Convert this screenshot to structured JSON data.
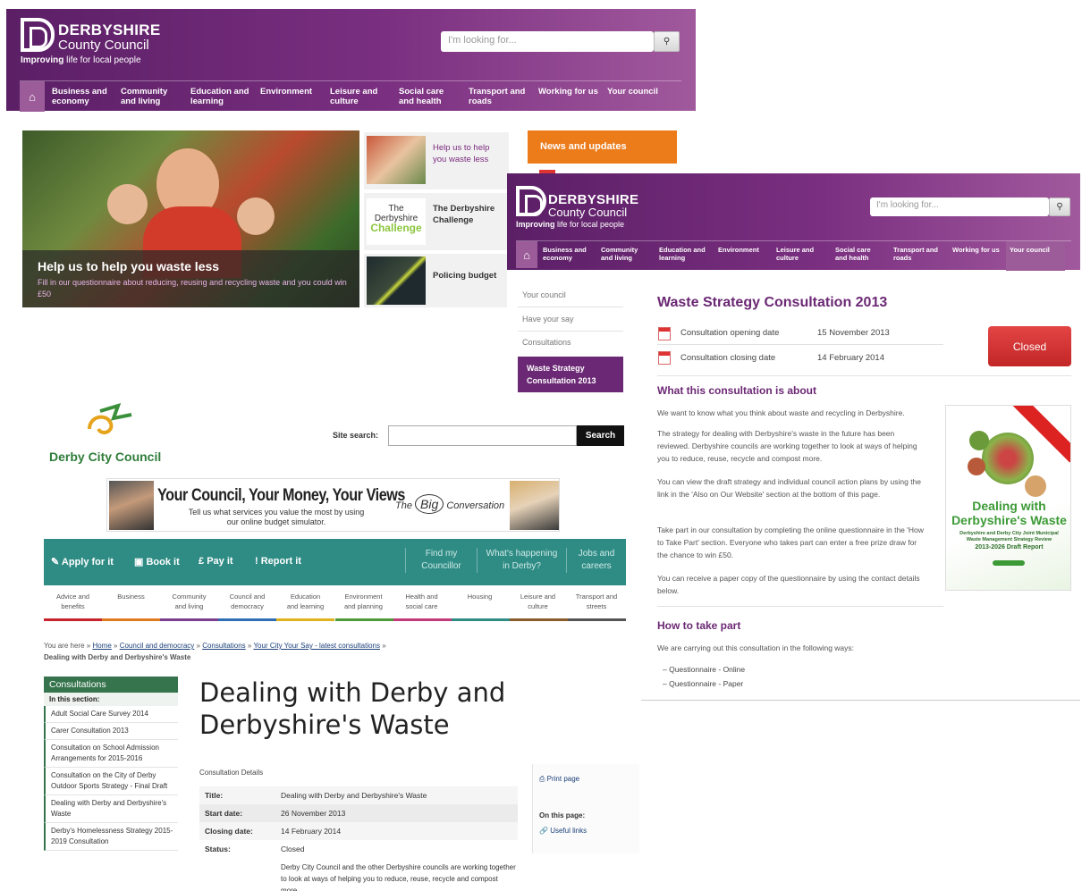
{
  "window_a": {
    "logo": {
      "name": "DERBYSHIRE",
      "sub": "County Council",
      "tagline_bold": "Improving",
      "tagline_rest": " life for local people"
    },
    "search": {
      "placeholder": "I'm looking for..."
    },
    "nav": [
      {
        "l1": "Business and",
        "l2": "economy"
      },
      {
        "l1": "Community",
        "l2": "and living"
      },
      {
        "l1": "Education and",
        "l2": "learning"
      },
      {
        "l1": "Environment",
        "l2": ""
      },
      {
        "l1": "Leisure and",
        "l2": "culture"
      },
      {
        "l1": "Social care",
        "l2": "and health"
      },
      {
        "l1": "Transport and",
        "l2": "roads"
      },
      {
        "l1": "Working for us",
        "l2": ""
      },
      {
        "l1": "Your council",
        "l2": ""
      }
    ],
    "hero": {
      "title": "Help us to help you waste less",
      "text": "Fill in our questionnaire about reducing, reusing and recycling waste and you could win £50"
    },
    "side": [
      {
        "text": "Help us to help you waste less"
      },
      {
        "logo_l1": "The",
        "logo_l2": "Derbyshire",
        "logo_l3": "Challenge",
        "text": "The Derbyshire Challenge"
      },
      {
        "text": "Policing budget"
      }
    ],
    "news": "News and updates"
  },
  "window_b": {
    "logo": {
      "name": "DERBYSHIRE",
      "sub": "County Council",
      "tagline_bold": "Improving",
      "tagline_rest": " life for local people"
    },
    "search": {
      "placeholder": "I'm looking for..."
    },
    "nav": [
      {
        "l1": "Business and",
        "l2": "economy"
      },
      {
        "l1": "Community",
        "l2": "and living"
      },
      {
        "l1": "Education and",
        "l2": "learning"
      },
      {
        "l1": "Environment",
        "l2": ""
      },
      {
        "l1": "Leisure and",
        "l2": "culture"
      },
      {
        "l1": "Social care",
        "l2": "and health"
      },
      {
        "l1": "Transport and",
        "l2": "roads"
      },
      {
        "l1": "Working for us",
        "l2": ""
      },
      {
        "l1": "Your council",
        "l2": ""
      }
    ],
    "leftnav": [
      "Your council",
      "Have your say",
      "Consultations"
    ],
    "leftnav_active_l1": "Waste Strategy",
    "leftnav_active_l2": "Consultation 2013",
    "title": "Waste Strategy Consultation 2013",
    "opening_label": "Consultation opening date",
    "opening_value": "15 November 2013",
    "closing_label": "Consultation closing date",
    "closing_value": "14 February 2014",
    "status_button": "Closed",
    "about_heading": "What this consultation is about",
    "paras": [
      "We want to know what you think about waste and recycling in Derbyshire.",
      "The strategy for dealing with Derbyshire's waste in the future has been reviewed. Derbyshire councils are working together to look at ways of helping you to reduce, reuse, recycle and compost more.",
      "You can view the draft strategy and individual council action plans by using the link in the 'Also on Our Website' section at the bottom of this page.",
      "Take part in our consultation by completing the online questionnaire in the 'How to Take Part' section. Everyone who takes part can enter a free prize draw for the chance to win £50.",
      "You can receive a paper copy of the questionnaire by using the contact details below."
    ],
    "report": {
      "title_l1": "Dealing with",
      "title_l2": "Derbyshire's Waste",
      "sub": "Derbyshire and Derby City Joint Municipal Waste Management Strategy Review",
      "draft": "2013-2026 Draft Report"
    },
    "take_part_heading": "How to take part",
    "take_part_intro": "We are carrying out this consultation in the following ways:",
    "ways": [
      "Questionnaire - Online",
      "Questionnaire - Paper"
    ]
  },
  "window_c": {
    "logo_text": "Derby City Council",
    "site_search_label": "Site search:",
    "search_button": "Search",
    "banner": {
      "title": "Your Council, Your Money, Your Views",
      "sub_l1": "Tell us what services you value the most by using",
      "sub_l2": "our online budget simulator.",
      "brand_pre": "The",
      "brand_big": "Big",
      "brand_post": "Conversation"
    },
    "actions": [
      "Apply for it",
      "Book it",
      "Pay it",
      "Report it"
    ],
    "action_icons": [
      "✎",
      "▣",
      "£",
      "!"
    ],
    "top_links": [
      {
        "l1": "Find my",
        "l2": "Councillor"
      },
      {
        "l1": "What's happening",
        "l2": "in Derby?"
      },
      {
        "l1": "Jobs and",
        "l2": "careers"
      }
    ],
    "categories": [
      {
        "l1": "Advice and",
        "l2": "benefits",
        "color": "#c8232c"
      },
      {
        "l1": "Business",
        "l2": "",
        "color": "#e07a1f"
      },
      {
        "l1": "Community",
        "l2": "and living",
        "color": "#7a3f8f"
      },
      {
        "l1": "Council and",
        "l2": "democracy",
        "color": "#2f6db5"
      },
      {
        "l1": "Education",
        "l2": "and learning",
        "color": "#e0b21f"
      },
      {
        "l1": "Environment",
        "l2": "and planning",
        "color": "#4d9a3a"
      },
      {
        "l1": "Health and",
        "l2": "social care",
        "color": "#c23a7a"
      },
      {
        "l1": "Housing",
        "l2": "",
        "color": "#2f8c85"
      },
      {
        "l1": "Leisure and",
        "l2": "culture",
        "color": "#8a5a2a"
      },
      {
        "l1": "Transport and",
        "l2": "streets",
        "color": "#555555"
      }
    ],
    "breadcrumb": {
      "prefix": "You are here »",
      "links": [
        "Home",
        "Council and democracy",
        "Consultations",
        "Your City Your Say - latest consultations"
      ],
      "current": "Dealing with Derby and Derbyshire's Waste"
    },
    "sidebar": {
      "head": "Consultations",
      "section": "In this section:",
      "items": [
        "Adult Social Care Survey 2014",
        "Carer Consultation 2013",
        "Consultation on School Admission Arrangements for 2015-2016",
        "Consultation on the City of Derby Outdoor Sports Strategy - Final Draft",
        "Dealing with Derby and Derbyshire's Waste",
        "Derby's Homelessness Strategy 2015-2019 Consultation"
      ]
    },
    "heading_l1": "Dealing with Derby and",
    "heading_l2": "Derbyshire's Waste",
    "details_label": "Consultation Details",
    "details": [
      {
        "label": "Title:",
        "value": "Dealing with Derby and Derbyshire's Waste"
      },
      {
        "label": "Start date:",
        "value": "26 November 2013"
      },
      {
        "label": "Closing date:",
        "value": "14 February 2014"
      },
      {
        "label": "Status:",
        "value": "Closed"
      }
    ],
    "description": "Derby City Council and the other Derbyshire councils are working together to look at ways of helping you to reduce, reuse, recycle and compost more.",
    "print": "Print page",
    "on_this_page": "On this page:",
    "useful_links": "Useful links"
  }
}
